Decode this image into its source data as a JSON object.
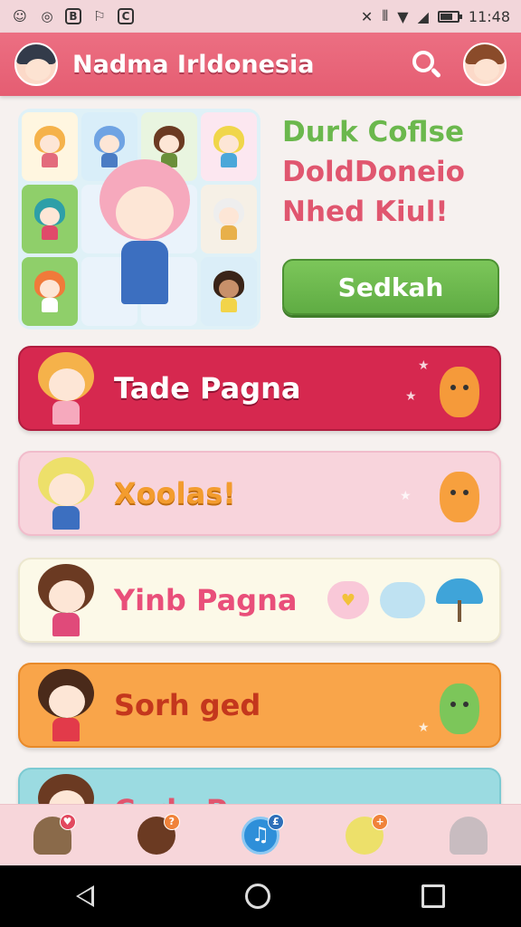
{
  "status_bar": {
    "time": "11:48",
    "icons": [
      "avatar-icon",
      "circle-icon",
      "b-icon",
      "flag-icon",
      "c-icon",
      "mute-icon",
      "vibrate-icon",
      "wifi-icon",
      "signal-icon",
      "battery-icon"
    ],
    "battery_level": 0.65
  },
  "app_bar": {
    "title": "Nadma Irldonesia"
  },
  "hero": {
    "line1": "Durk Coflse",
    "line2": "DoldDoneio",
    "line3": "Nhed Kiul!",
    "button_label": "Sedkah"
  },
  "cards": [
    {
      "label": "Tade Pagna",
      "color": "#d6284f"
    },
    {
      "label": "Xoolas!",
      "color": "#f8d4dc"
    },
    {
      "label": "Yinb Pagna",
      "color": "#fcf9e8"
    },
    {
      "label": "Sorh ged",
      "color": "#f9a54a"
    },
    {
      "label": "Cnda Pagna",
      "color": "#9bdbe1"
    }
  ],
  "bottom_nav": {
    "items": [
      {
        "name": "house",
        "badge": "♥"
      },
      {
        "name": "friend",
        "badge": "?"
      },
      {
        "name": "music",
        "badge": "£"
      },
      {
        "name": "profile",
        "badge": "+"
      },
      {
        "name": "shop",
        "badge": ""
      }
    ]
  },
  "colors": {
    "accent": "#e55d72",
    "green": "#6bb84d",
    "pink": "#e0566f"
  }
}
